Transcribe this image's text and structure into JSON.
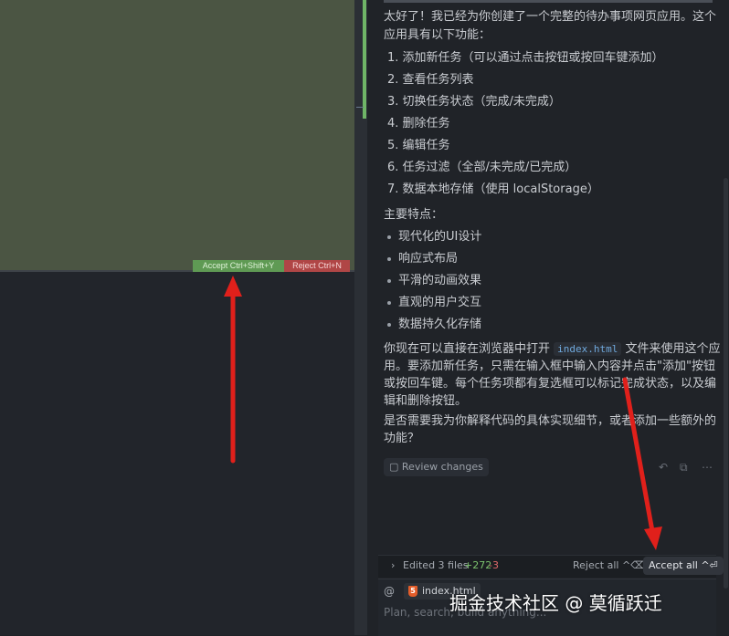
{
  "editor": {
    "accept_label": "Accept  Ctrl+Shift+Y",
    "reject_label": "Reject  Ctrl+N"
  },
  "chat": {
    "intro_line1": "太好了！我已经为你创建了一个完整的待办事项网页应用。这个",
    "intro_line2": "应用具有以下功能：",
    "features": [
      "1. 添加新任务（可以通过点击按钮或按回车键添加）",
      "2. 查看任务列表",
      "3. 切换任务状态（完成/未完成）",
      "4. 删除任务",
      "5. 编辑任务",
      "6. 任务过滤（全部/未完成/已完成）",
      "7. 数据本地存储（使用 localStorage）"
    ],
    "highlights_heading": "主要特点：",
    "highlights": [
      "现代化的UI设计",
      "响应式布局",
      "平滑的动画效果",
      "直观的用户交互",
      "数据持久化存储"
    ],
    "para_pre": "你现在可以直接在浏览器中打开",
    "para_code": "index.html",
    "para_post": "文件来使用这个应",
    "para_line2": "用。要添加新任务，只需在输入框中输入内容并点击\"添加\"按钮",
    "para_line3": "或按回车键。每个任务项都有复选框可以标记完成状态，以及编",
    "para_line4": "辑和删除按钮。",
    "question_line1": "是否需要我为你解释代码的具体实现细节，或者添加一些额外的",
    "question_line2": "功能？",
    "review_label": "Review changes"
  },
  "bottom": {
    "edited_label": "Edited 3 files",
    "added_count": "+272",
    "removed_count": "-3",
    "reject_all_label": "Reject all ^⌫",
    "accept_all_label": "Accept all ^⏎"
  },
  "input": {
    "file_chip": "index.html",
    "placeholder": "Plan, search, build anything..."
  },
  "watermark": "掘金技术社区 @ 莫循跃迁",
  "colors": {
    "diff_added_bg": "#4b5543",
    "accept": "#5f9a54",
    "reject": "#b04646",
    "arrow": "#e0201b",
    "added_count": "#7cc36e",
    "removed_count": "#e06a6a"
  }
}
